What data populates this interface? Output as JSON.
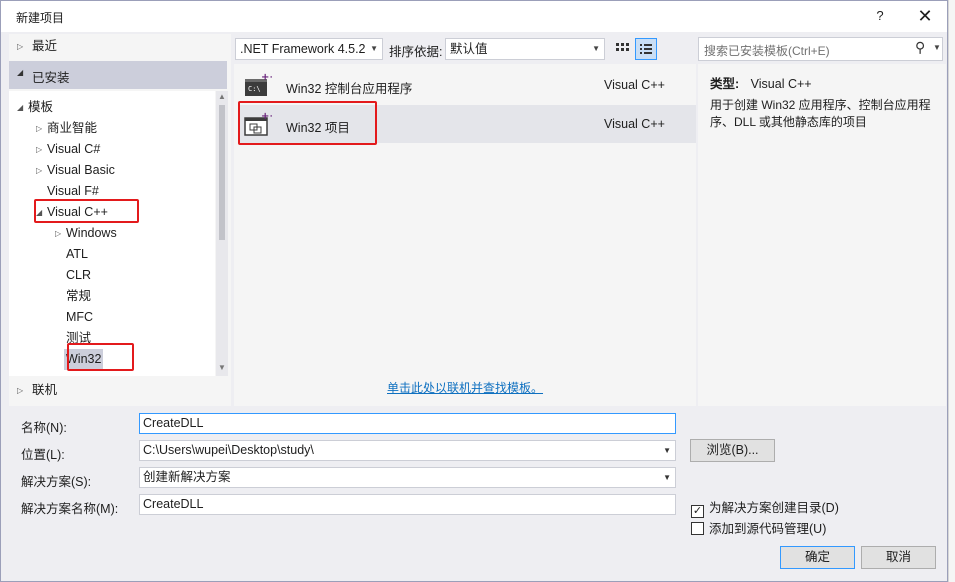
{
  "window": {
    "title": "新建项目",
    "help": "?",
    "close": "✕"
  },
  "left_panel": {
    "recent": "最近",
    "installed": "已安装",
    "online": "联机",
    "tree": [
      {
        "label": "模板",
        "level": 0,
        "arrow": "◢"
      },
      {
        "label": "商业智能",
        "level": 1,
        "arrow": "▷"
      },
      {
        "label": "Visual C#",
        "level": 1,
        "arrow": "▷"
      },
      {
        "label": "Visual Basic",
        "level": 1,
        "arrow": "▷"
      },
      {
        "label": "Visual F#",
        "level": 1,
        "arrow": ""
      },
      {
        "label": "Visual C++",
        "level": 1,
        "arrow": "◢"
      },
      {
        "label": "Windows",
        "level": 2,
        "arrow": "▷"
      },
      {
        "label": "ATL",
        "level": 2,
        "arrow": ""
      },
      {
        "label": "CLR",
        "level": 2,
        "arrow": ""
      },
      {
        "label": "常规",
        "level": 2,
        "arrow": ""
      },
      {
        "label": "MFC",
        "level": 2,
        "arrow": ""
      },
      {
        "label": "测试",
        "level": 2,
        "arrow": ""
      },
      {
        "label": "Win32",
        "level": 2,
        "arrow": ""
      }
    ]
  },
  "toolbar": {
    "framework": ".NET Framework 4.5.2",
    "sort_label": "排序依据:",
    "sort_value": "默认值"
  },
  "search": {
    "placeholder": "搜索已安装模板(Ctrl+E)"
  },
  "templates": [
    {
      "name": "Win32 控制台应用程序",
      "lang": "Visual C++"
    },
    {
      "name": "Win32 项目",
      "lang": "Visual C++"
    }
  ],
  "online_link": "单击此处以联机并查找模板。",
  "details": {
    "type_label": "类型:",
    "type_value": "Visual C++",
    "description": "用于创建 Win32 应用程序、控制台应用程序、DLL 或其他静态库的项目"
  },
  "form": {
    "name_label": "名称(N):",
    "name_value": "CreateDLL",
    "location_label": "位置(L):",
    "location_value": "C:\\Users\\wupei\\Desktop\\study\\",
    "solution_label": "解决方案(S):",
    "solution_value": "创建新解决方案",
    "solution_name_label": "解决方案名称(M):",
    "solution_name_value": "CreateDLL",
    "browse": "浏览(B)...",
    "create_dir": "为解决方案创建目录(D)",
    "create_dir_checked": true,
    "add_source_control": "添加到源代码管理(U)",
    "add_source_control_checked": false,
    "ok": "确定",
    "cancel": "取消"
  }
}
